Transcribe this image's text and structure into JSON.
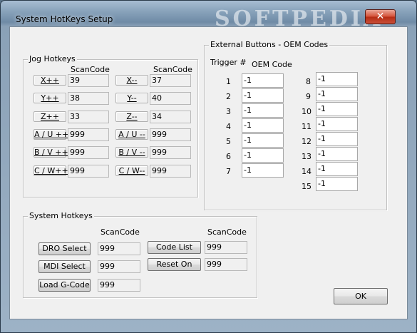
{
  "window": {
    "title": "System HotKeys Setup",
    "watermark": "SOFTPEDIA",
    "close_glyph": "✕"
  },
  "jog": {
    "title": "Jog Hotkeys",
    "scancode_header": "ScanCode",
    "left": [
      {
        "label": "X++",
        "value": "39"
      },
      {
        "label": "Y++",
        "value": "38"
      },
      {
        "label": "Z++",
        "value": "33"
      },
      {
        "label": "A / U ++",
        "value": "999"
      },
      {
        "label": "B / V ++",
        "value": "999"
      },
      {
        "label": "C / W++",
        "value": "999"
      }
    ],
    "right": [
      {
        "label": "X--",
        "value": "37"
      },
      {
        "label": "Y--",
        "value": "40"
      },
      {
        "label": "Z--",
        "value": "34"
      },
      {
        "label": "A / U --",
        "value": "999"
      },
      {
        "label": "B / V --",
        "value": "999"
      },
      {
        "label": "C / W--",
        "value": "999"
      }
    ]
  },
  "external": {
    "title": "External Buttons - OEM Codes",
    "trigger_header": "Trigger  #",
    "oem_header": "OEM Code",
    "left": [
      {
        "num": "1",
        "value": "-1"
      },
      {
        "num": "2",
        "value": "-1"
      },
      {
        "num": "3",
        "value": "-1"
      },
      {
        "num": "4",
        "value": "-1"
      },
      {
        "num": "5",
        "value": "-1"
      },
      {
        "num": "6",
        "value": "-1"
      },
      {
        "num": "7",
        "value": "-1"
      }
    ],
    "right": [
      {
        "num": "8",
        "value": "-1"
      },
      {
        "num": "9",
        "value": "-1"
      },
      {
        "num": "10",
        "value": "-1"
      },
      {
        "num": "11",
        "value": "-1"
      },
      {
        "num": "12",
        "value": "-1"
      },
      {
        "num": "13",
        "value": "-1"
      },
      {
        "num": "14",
        "value": "-1"
      },
      {
        "num": "15",
        "value": "-1"
      }
    ]
  },
  "system": {
    "title": "System Hotkeys",
    "scancode_header_left": "ScanCode",
    "scancode_header_right": "ScanCode",
    "left": [
      {
        "label": "DRO Select",
        "value": "999"
      },
      {
        "label": "MDI Select",
        "value": "999"
      },
      {
        "label": "Load G-Code",
        "value": "999"
      }
    ],
    "right": [
      {
        "label": "Code List",
        "value": "999"
      },
      {
        "label": "Reset On",
        "value": "999"
      }
    ]
  },
  "ok_label": "OK"
}
